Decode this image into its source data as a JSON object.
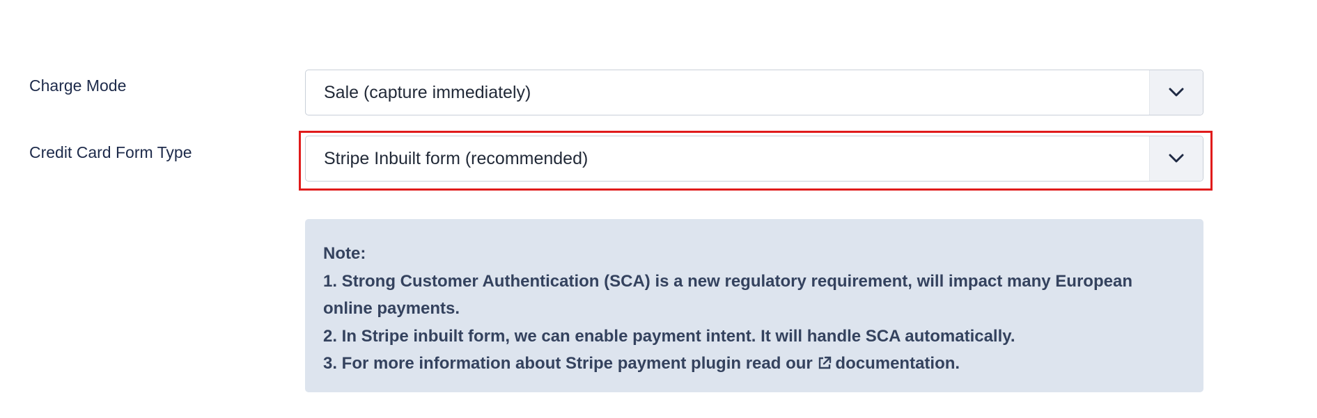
{
  "fields": {
    "charge_mode": {
      "label": "Charge Mode",
      "value": "Sale (capture immediately)"
    },
    "card_form_type": {
      "label": "Credit Card Form Type",
      "value": "Stripe Inbuilt form (recommended)"
    }
  },
  "note": {
    "heading": "Note:",
    "line1": "1. Strong Customer Authentication (SCA) is a new regulatory requirement, will impact many European online payments.",
    "line2": "2. In Stripe inbuilt form, we can enable payment intent. It will handle SCA automatically.",
    "line3_prefix": "3. For more information about Stripe payment plugin read our",
    "line3_link": "documentation."
  },
  "icons": {
    "dropdown": "chevron-down-icon",
    "link": "external-link-icon"
  },
  "colors": {
    "highlight_border": "#e01b1b",
    "note_background": "#dde4ee"
  }
}
